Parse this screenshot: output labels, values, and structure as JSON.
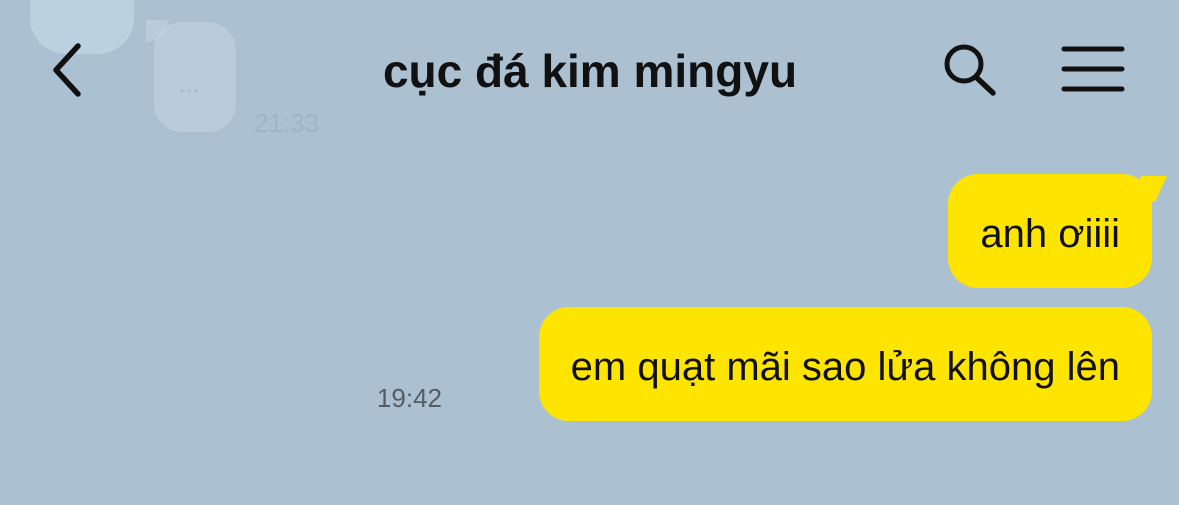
{
  "background_color": "#abc1d1",
  "accent_color": "#fee500",
  "ghost": {
    "dots": "…",
    "time": "21:33"
  },
  "header": {
    "title": "cục đá kim mingyu",
    "back_icon": "chevron-left-icon",
    "search_icon": "search-icon",
    "menu_icon": "hamburger-menu-icon"
  },
  "messages": [
    {
      "text": "anh ơiiii",
      "sender": "me"
    },
    {
      "text": "em quạt mãi sao lửa không lên",
      "sender": "me",
      "time": "19:42"
    }
  ]
}
